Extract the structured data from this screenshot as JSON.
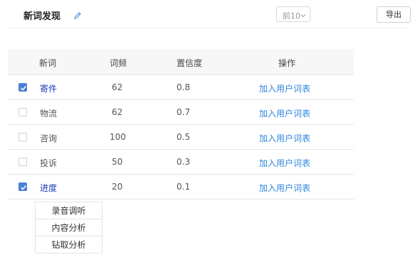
{
  "header": {
    "title": "新词发现",
    "edit_icon": "pencil-icon",
    "top_select": {
      "value": "前10",
      "icon": "chevron-down-icon"
    },
    "export_label": "导出"
  },
  "colors": {
    "accent": "#4a7fd6",
    "link": "#2e86de",
    "selected_word": "#1a3db8"
  },
  "table": {
    "columns": [
      "新词",
      "词频",
      "置信度",
      "操作"
    ],
    "rows": [
      {
        "checked": true,
        "word": "寄件",
        "freq": "62",
        "confidence": "0.8",
        "action": "加入用户词表"
      },
      {
        "checked": false,
        "word": "物流",
        "freq": "62",
        "confidence": "0.7",
        "action": "加入用户词表"
      },
      {
        "checked": false,
        "word": "咨询",
        "freq": "100",
        "confidence": "0.5",
        "action": "加入用户词表"
      },
      {
        "checked": false,
        "word": "投诉",
        "freq": "50",
        "confidence": "0.3",
        "action": "加入用户词表"
      },
      {
        "checked": true,
        "word": "进度",
        "freq": "20",
        "confidence": "0.1",
        "action": "加入用户词表"
      }
    ]
  },
  "menu": {
    "items": [
      "录音调听",
      "内容分析",
      "钻取分析"
    ]
  }
}
